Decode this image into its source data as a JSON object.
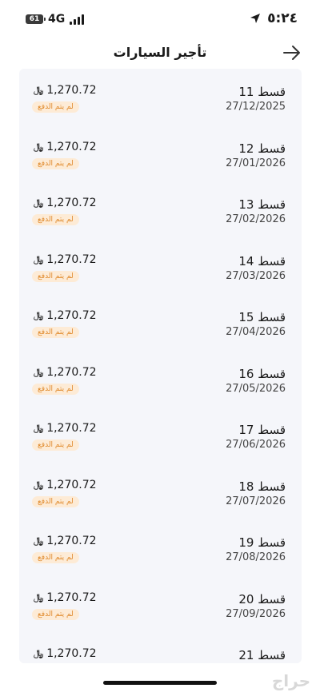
{
  "status_bar": {
    "time": "٥:٢٤",
    "network": "4G",
    "battery": "61"
  },
  "header": {
    "title": "تأجير السيارات"
  },
  "installments": [
    {
      "title": "قسط 11",
      "date": "27/12/2025",
      "amount": "1,270.72",
      "currency": "﷼",
      "status": "لم يتم الدفع"
    },
    {
      "title": "قسط 12",
      "date": "27/01/2026",
      "amount": "1,270.72",
      "currency": "﷼",
      "status": "لم يتم الدفع"
    },
    {
      "title": "قسط 13",
      "date": "27/02/2026",
      "amount": "1,270.72",
      "currency": "﷼",
      "status": "لم يتم الدفع"
    },
    {
      "title": "قسط 14",
      "date": "27/03/2026",
      "amount": "1,270.72",
      "currency": "﷼",
      "status": "لم يتم الدفع"
    },
    {
      "title": "قسط 15",
      "date": "27/04/2026",
      "amount": "1,270.72",
      "currency": "﷼",
      "status": "لم يتم الدفع"
    },
    {
      "title": "قسط 16",
      "date": "27/05/2026",
      "amount": "1,270.72",
      "currency": "﷼",
      "status": "لم يتم الدفع"
    },
    {
      "title": "قسط 17",
      "date": "27/06/2026",
      "amount": "1,270.72",
      "currency": "﷼",
      "status": "لم يتم الدفع"
    },
    {
      "title": "قسط 18",
      "date": "27/07/2026",
      "amount": "1,270.72",
      "currency": "﷼",
      "status": "لم يتم الدفع"
    },
    {
      "title": "قسط 19",
      "date": "27/08/2026",
      "amount": "1,270.72",
      "currency": "﷼",
      "status": "لم يتم الدفع"
    },
    {
      "title": "قسط 20",
      "date": "27/09/2026",
      "amount": "1,270.72",
      "currency": "﷼",
      "status": "لم يتم الدفع"
    },
    {
      "title": "قسط 21",
      "amount": "1,270.72",
      "currency": "﷼"
    }
  ],
  "watermark": "حراج",
  "colors": {
    "status_badge_bg": "#fdebd6",
    "status_badge_text": "#e08a2c",
    "list_bg": "#f5f6fa"
  }
}
